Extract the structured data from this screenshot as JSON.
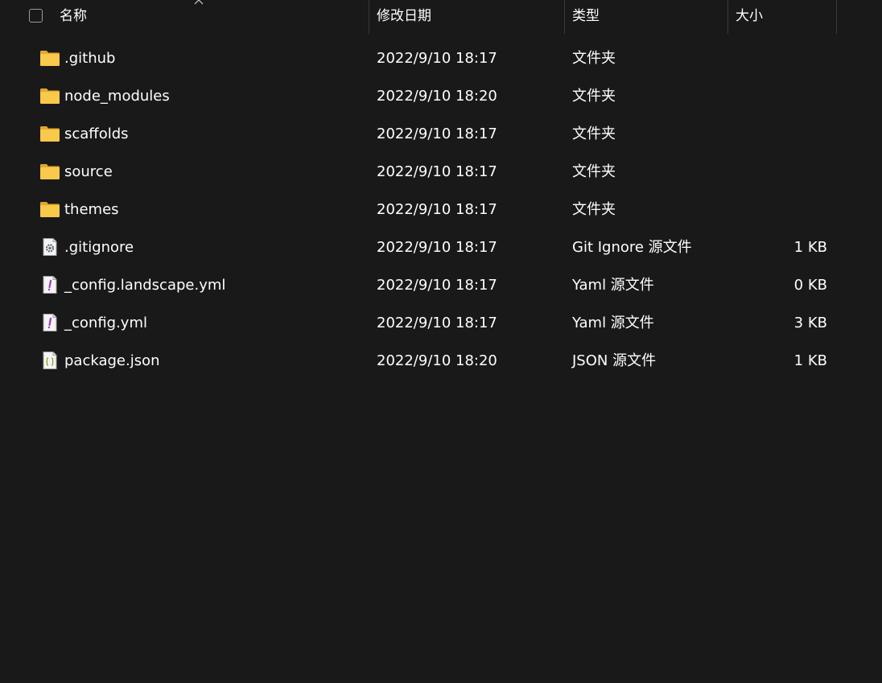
{
  "header": {
    "name": "名称",
    "date": "修改日期",
    "type": "类型",
    "size": "大小"
  },
  "files": [
    {
      "name": ".github",
      "date": "2022/9/10 18:17",
      "type": "文件夹",
      "size": "",
      "icon": "folder-icon"
    },
    {
      "name": "node_modules",
      "date": "2022/9/10 18:20",
      "type": "文件夹",
      "size": "",
      "icon": "folder-icon"
    },
    {
      "name": "scaffolds",
      "date": "2022/9/10 18:17",
      "type": "文件夹",
      "size": "",
      "icon": "folder-icon"
    },
    {
      "name": "source",
      "date": "2022/9/10 18:17",
      "type": "文件夹",
      "size": "",
      "icon": "folder-icon"
    },
    {
      "name": "themes",
      "date": "2022/9/10 18:17",
      "type": "文件夹",
      "size": "",
      "icon": "folder-icon"
    },
    {
      "name": ".gitignore",
      "date": "2022/9/10 18:17",
      "type": "Git Ignore 源文件",
      "size": "1 KB",
      "icon": "gear-file-icon"
    },
    {
      "name": "_config.landscape.yml",
      "date": "2022/9/10 18:17",
      "type": "Yaml 源文件",
      "size": "0 KB",
      "icon": "yaml-file-icon"
    },
    {
      "name": "_config.yml",
      "date": "2022/9/10 18:17",
      "type": "Yaml 源文件",
      "size": "3 KB",
      "icon": "yaml-file-icon"
    },
    {
      "name": "package.json",
      "date": "2022/9/10 18:20",
      "type": "JSON 源文件",
      "size": "1 KB",
      "icon": "json-file-icon"
    }
  ],
  "colors": {
    "background": "#191919",
    "text": "#ffffff",
    "folder": "#f8c94a",
    "folder_dark": "#e0a82e",
    "separator": "#3a3a3a"
  }
}
